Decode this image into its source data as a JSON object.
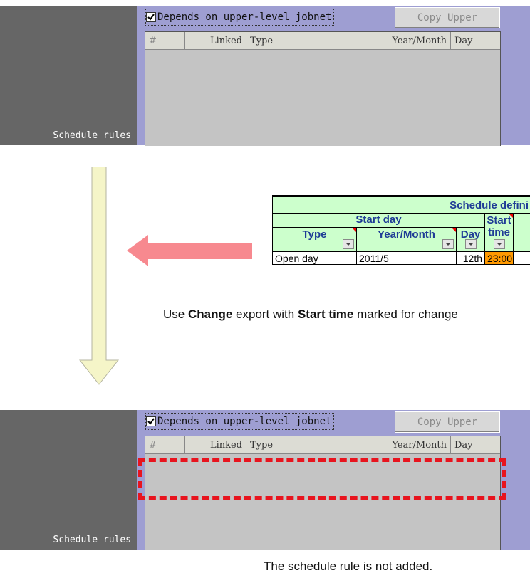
{
  "panel": {
    "side_label": "Schedule rules",
    "checkbox_label": "Depends on upper-level jobnet",
    "checkbox_checked": true,
    "copy_button": "Copy Upper",
    "columns": [
      "#",
      "Linked",
      "Type",
      "Year/Month",
      "Day"
    ]
  },
  "excel": {
    "title": "Schedule defini",
    "group_start_day": "Start day",
    "col_type": "Type",
    "col_year_month": "Year/Month",
    "col_day": "Day",
    "col_start_line1": "Start",
    "col_start_line2": "time",
    "row": {
      "type": "Open day",
      "year_month": "2011/5",
      "day": "12th",
      "start_time": "23:00"
    },
    "highlight_color": "#ff9900"
  },
  "caption_middle": {
    "prefix": "Use ",
    "bold1": "Change",
    "middle": " export with ",
    "bold2": "Start time",
    "suffix": " marked for change"
  },
  "caption_bottom": "The schedule rule is not added.",
  "colors": {
    "vertical_arrow": "#f5f5c8",
    "horizontal_arrow": "#f7898f",
    "dashed_highlight": "#e8141e"
  }
}
